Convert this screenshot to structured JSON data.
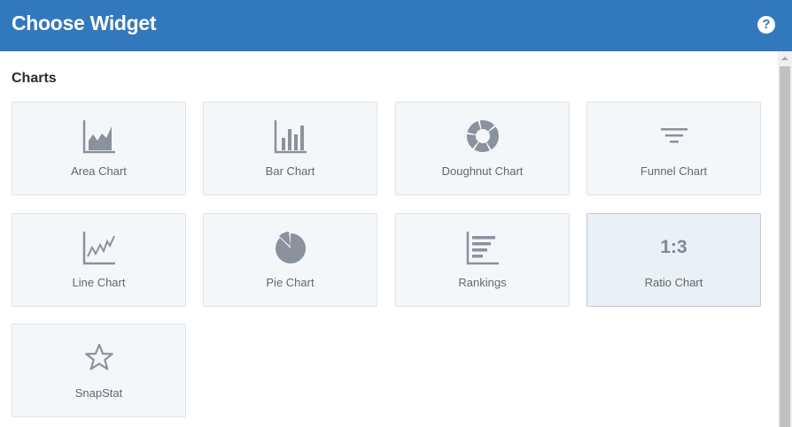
{
  "header": {
    "title": "Choose Widget",
    "help_glyph": "?"
  },
  "section": {
    "title": "Charts"
  },
  "widgets": [
    {
      "label": "Area Chart",
      "icon": "area-chart-icon"
    },
    {
      "label": "Bar Chart",
      "icon": "bar-chart-icon"
    },
    {
      "label": "Doughnut Chart",
      "icon": "doughnut-chart-icon"
    },
    {
      "label": "Funnel Chart",
      "icon": "funnel-chart-icon"
    },
    {
      "label": "Line Chart",
      "icon": "line-chart-icon"
    },
    {
      "label": "Pie Chart",
      "icon": "pie-chart-icon"
    },
    {
      "label": "Rankings",
      "icon": "rankings-icon"
    },
    {
      "label": "Ratio Chart",
      "icon": "ratio-icon",
      "icon_text": "1:3",
      "selected": true
    },
    {
      "label": "SnapStat",
      "icon": "star-icon"
    }
  ],
  "colors": {
    "header_bg": "#3278bd",
    "tile_bg": "#f4f7fa",
    "tile_selected_bg": "#ebeff6",
    "icon": "#8a929e"
  }
}
